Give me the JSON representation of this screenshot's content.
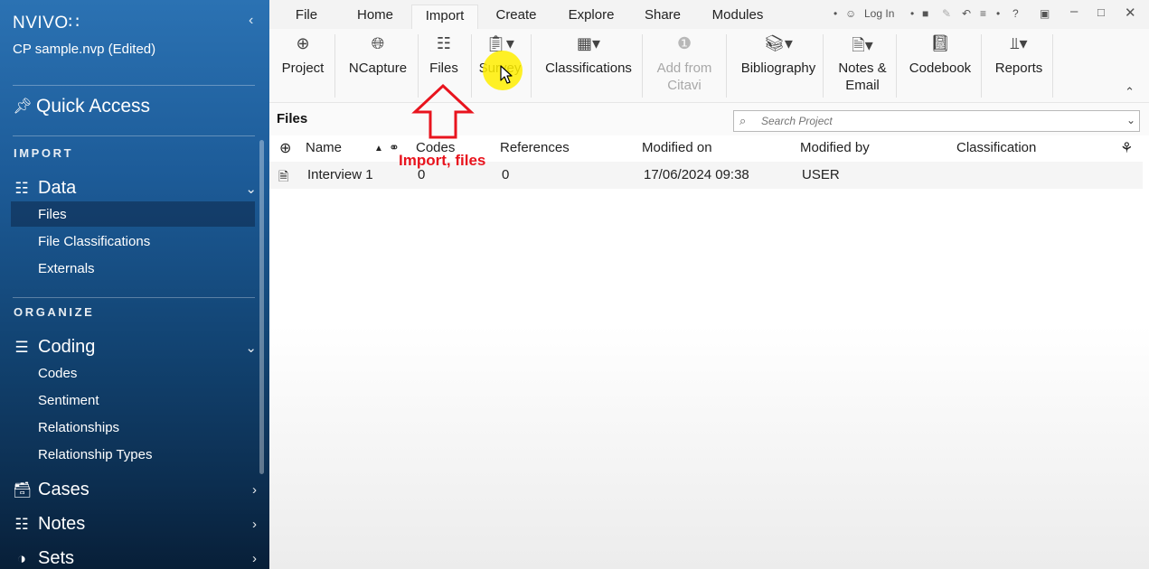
{
  "sidebar": {
    "logo": "NVIVO∷",
    "collapse_icon": "chevron-left",
    "project_name": "CP sample.nvp (Edited)",
    "quick_access": "Quick Access",
    "sections": {
      "import": "IMPORT",
      "organize": "ORGANIZE"
    },
    "data_group": {
      "label": "Data",
      "items": [
        "Files",
        "File Classifications",
        "Externals"
      ]
    },
    "coding_group": {
      "label": "Coding",
      "items": [
        "Codes",
        "Sentiment",
        "Relationships",
        "Relationship Types"
      ]
    },
    "cases_label": "Cases",
    "notes_label": "Notes",
    "sets_label": "Sets",
    "selected_item": "Files"
  },
  "menubar": {
    "tabs": [
      "File",
      "Home",
      "Import",
      "Create",
      "Explore",
      "Share",
      "Modules"
    ],
    "active_tab": "Import",
    "login_label": "Log In",
    "help": "?"
  },
  "ribbon": {
    "project": "Project",
    "ncapture": "NCapture",
    "files": "Files",
    "survey": "Survey",
    "classifications": "Classifications",
    "add_from_citavi_1": "Add from",
    "add_from_citavi_2": "Citavi",
    "bibliography": "Bibliography",
    "notes_email_1": "Notes &",
    "notes_email_2": "Email",
    "codebook": "Codebook",
    "reports": "Reports"
  },
  "files_panel": {
    "title": "Files",
    "search_placeholder": "Search Project"
  },
  "table": {
    "headers": [
      "Name",
      "Codes",
      "References",
      "Modified on",
      "Modified by",
      "Classification"
    ],
    "rows": [
      {
        "name": "Interview 1",
        "codes": "0",
        "references": "0",
        "modified_on": "17/06/2024 09:38",
        "modified_by": "USER",
        "classification": ""
      }
    ]
  },
  "annotation": {
    "text": "Import, files",
    "color": "#e8141e"
  },
  "colors": {
    "sidebar_top": "#2b72b3",
    "sidebar_bottom": "#081f38",
    "highlight": "#ffee00"
  }
}
